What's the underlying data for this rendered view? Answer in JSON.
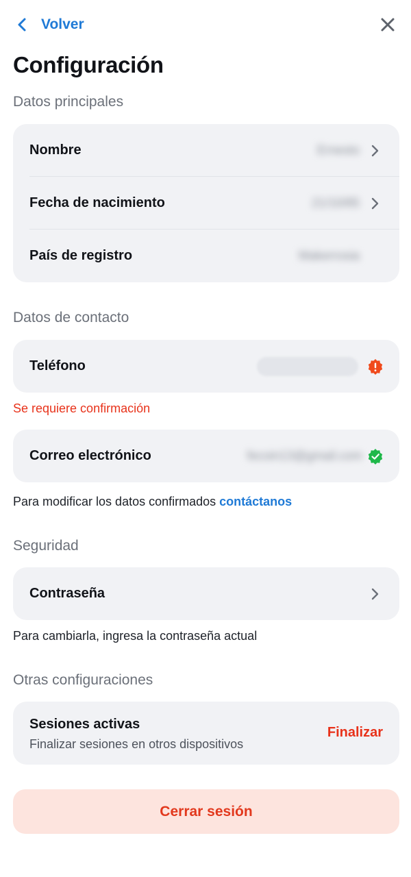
{
  "header": {
    "back_label": "Volver",
    "back_icon": "chevron-left-icon",
    "close_icon": "close-icon",
    "title": "Configuración"
  },
  "sections": {
    "main": {
      "title": "Datos principales",
      "rows": [
        {
          "label": "Nombre",
          "value": "Ernesto"
        },
        {
          "label": "Fecha de nacimiento",
          "value": "21/10/85"
        },
        {
          "label": "País de registro",
          "value": "Makerrosia"
        }
      ]
    },
    "contact": {
      "title": "Datos de contacto",
      "phone": {
        "label": "Teléfono",
        "status_icon": "warning-icon",
        "status_color": "#f04a1c"
      },
      "phone_warning": "Se requiere confirmación",
      "email": {
        "label": "Correo electrónico",
        "value": "fecoin13@gmail.com",
        "status_icon": "verified-check-icon",
        "status_color": "#1fb84a"
      },
      "note_text": "Para modificar los datos confirmados ",
      "note_link": "contáctanos"
    },
    "security": {
      "title": "Seguridad",
      "password_label": "Contraseña",
      "note": "Para cambiarla, ingresa la contraseña actual"
    },
    "other": {
      "title": "Otras configuraciones",
      "sessions_title": "Sesiones activas",
      "sessions_sub": "Finalizar sesiones en otros dispositivos",
      "sessions_action": "Finalizar"
    }
  },
  "logout_label": "Cerrar sesión",
  "colors": {
    "accent": "#1f7ad6",
    "danger": "#e8321a",
    "card_bg": "#f1f2f5",
    "logout_bg": "#fde4de"
  }
}
